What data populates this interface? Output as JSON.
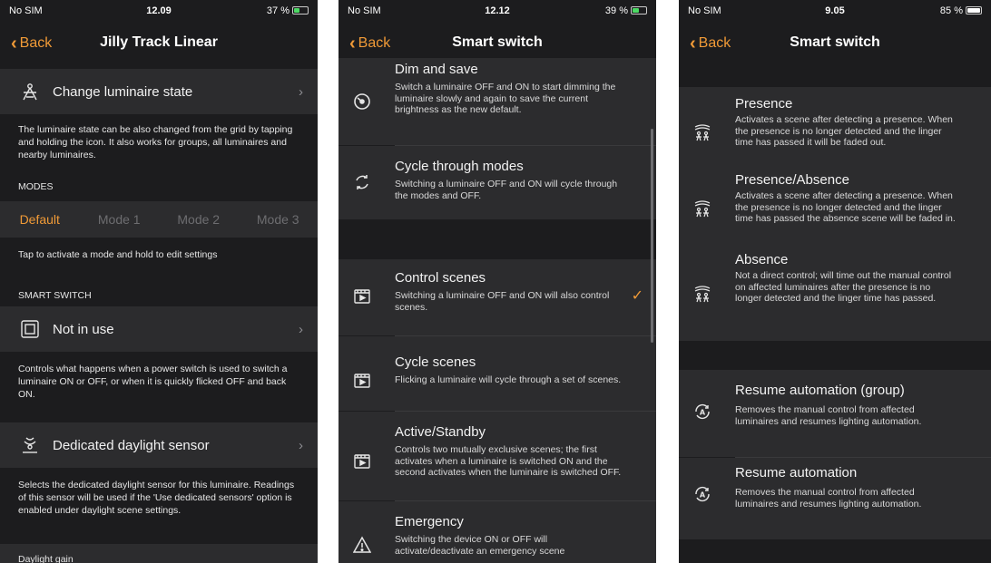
{
  "panel1": {
    "status": {
      "carrier": "No SIM",
      "time": "12.09",
      "battery": "37 %"
    },
    "nav": {
      "back": "Back",
      "title": "Jilly Track Linear"
    },
    "change_state": {
      "label": "Change luminaire state",
      "icon": "luminaire-icon"
    },
    "change_state_desc": "The luminaire state can be also changed from the grid by tapping and holding the icon. It also works for groups, all luminaires and nearby luminaires.",
    "modes_header": "MODES",
    "modes": [
      "Default",
      "Mode 1",
      "Mode 2",
      "Mode 3"
    ],
    "active_mode": "Default",
    "modes_hint": "Tap to activate a mode and hold to edit settings",
    "smart_switch_header": "SMART SWITCH",
    "smart_switch": {
      "label": "Not in use",
      "icon": "switch-icon"
    },
    "smart_switch_desc": "Controls what happens when a power switch is used to switch a luminaire ON or OFF, or when it is quickly flicked OFF and back ON.",
    "daylight": {
      "label": "Dedicated daylight sensor",
      "icon": "daylight-sensor-icon"
    },
    "daylight_desc": "Selects the dedicated daylight sensor for this luminaire. Readings of this sensor will be used if the 'Use dedicated sensors' option is enabled under daylight scene settings.",
    "daylight_gain": "Daylight gain"
  },
  "panel2": {
    "status": {
      "carrier": "No SIM",
      "time": "12.12",
      "battery": "39 %"
    },
    "nav": {
      "back": "Back",
      "title": "Smart switch"
    },
    "options": [
      {
        "title": "Dim and save",
        "desc": "Switch a luminaire OFF and ON to start dimming the luminaire slowly and again to save the current brightness as the new default.",
        "icon": "dim-icon"
      },
      {
        "title": "Cycle through modes",
        "desc": "Switching a luminaire OFF and ON will cycle through the modes and OFF.",
        "icon": "cycle-icon"
      },
      {
        "title": "Control scenes",
        "desc": "Switching a luminaire OFF and ON will also control scenes.",
        "icon": "scene-icon",
        "selected": true
      },
      {
        "title": "Cycle scenes",
        "desc": "Flicking a luminaire will cycle through a set of scenes.",
        "icon": "scene-icon"
      },
      {
        "title": "Active/Standby",
        "desc": "Controls two mutually exclusive scenes; the first activates when a luminaire is switched ON and the second activates when the luminaire is switched OFF.",
        "icon": "scene-icon"
      },
      {
        "title": "Emergency",
        "desc": "Switching the device ON or OFF will activate/deactivate an emergency scene",
        "icon": "warning-icon"
      }
    ],
    "check_glyph": "✓"
  },
  "panel3": {
    "status": {
      "carrier": "No SIM",
      "time": "9.05",
      "battery": "85 %"
    },
    "nav": {
      "back": "Back",
      "title": "Smart switch"
    },
    "options": [
      {
        "title": "Presence",
        "desc": "Activates a scene after detecting a presence. When the presence is no longer detected and the linger time has passed it will be faded out.",
        "icon": "presence-icon"
      },
      {
        "title": "Presence/Absence",
        "desc": "Activates a scene after detecting a presence. When the presence is no longer detected and the linger time has passed the absence scene will be faded in.",
        "icon": "presence-icon"
      },
      {
        "title": "Absence",
        "desc": "Not a direct control; will time out the manual control on affected luminaires after the presence is no longer detected and the linger time has passed.",
        "icon": "presence-icon"
      },
      {
        "title": "Resume automation (group)",
        "desc": "Removes the manual control from affected luminaires and resumes lighting automation.",
        "icon": "automation-icon"
      },
      {
        "title": "Resume automation",
        "desc": "Removes the manual control from affected luminaires and resumes lighting automation.",
        "icon": "automation-icon"
      }
    ]
  },
  "colors": {
    "accent": "#f09a37",
    "background": "#1c1c1e",
    "cell": "#2c2c2e"
  }
}
